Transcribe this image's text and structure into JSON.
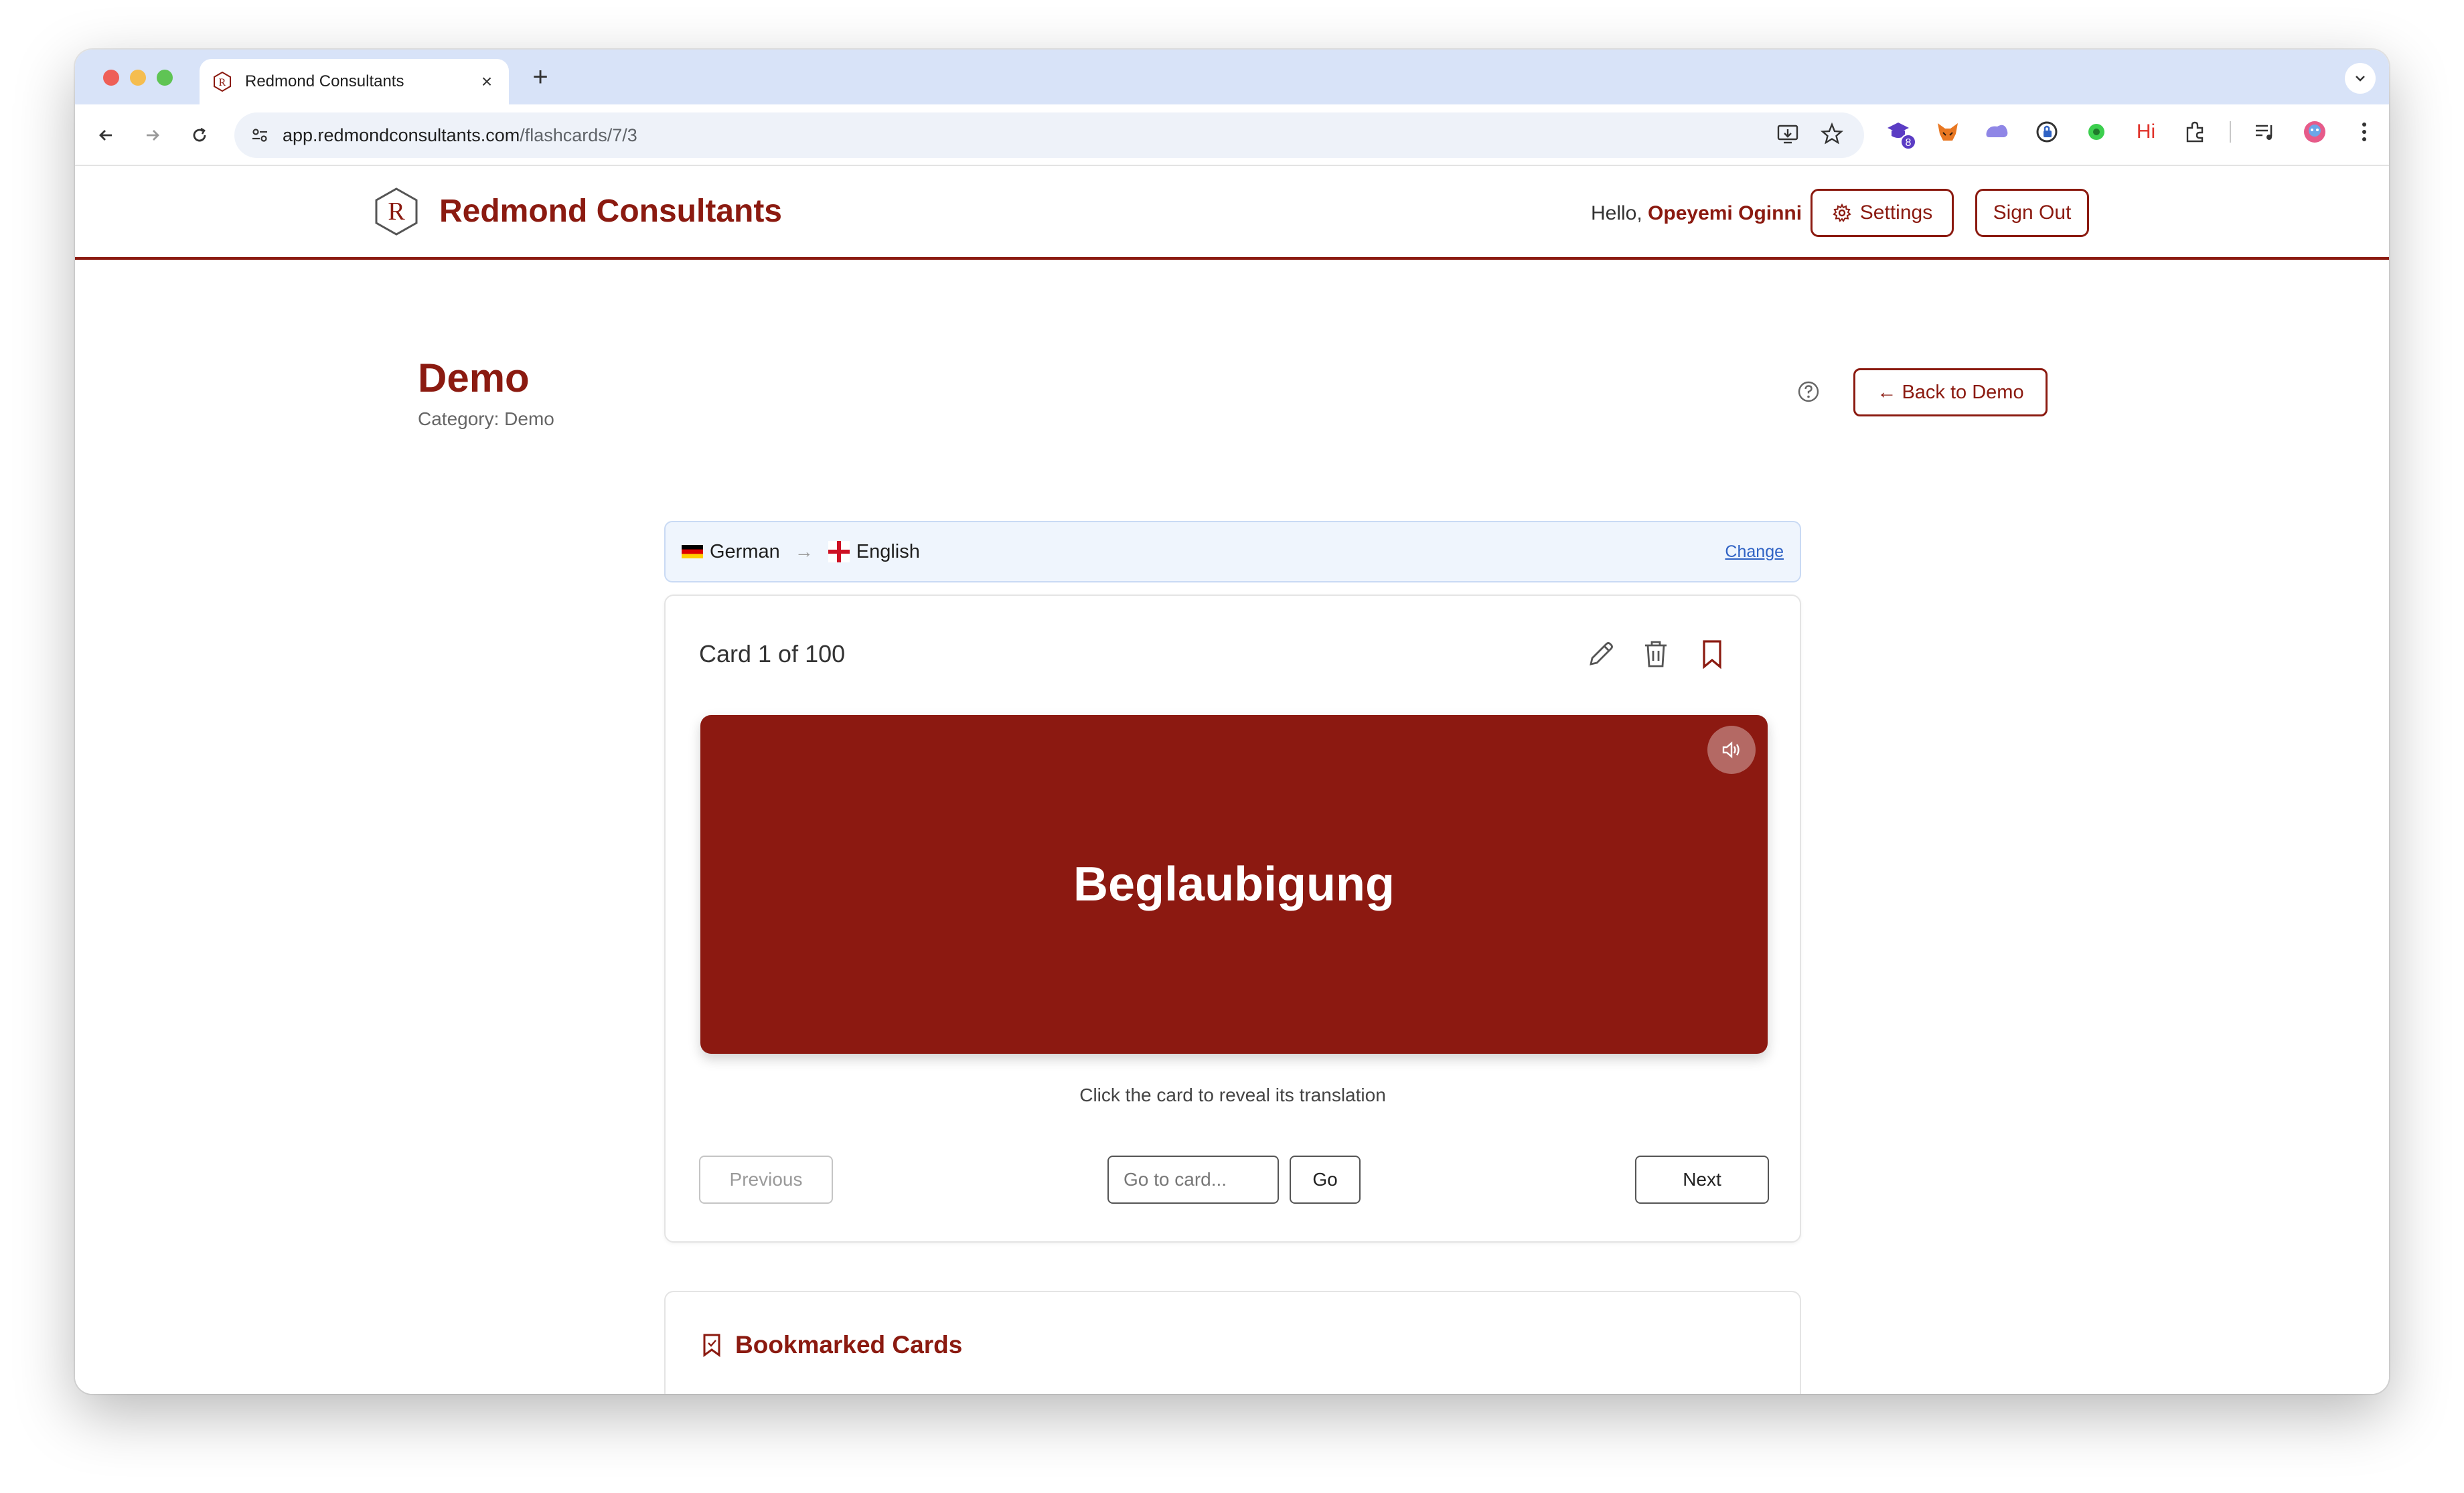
{
  "browser": {
    "tab_title": "Redmond Consultants",
    "tab_close": "×",
    "new_tab": "+",
    "url_domain": "app.redmondconsultants.com",
    "url_path": "/flashcards/7/3",
    "extension_badge": "8",
    "ext_hi": "Hi"
  },
  "header": {
    "brand": "Redmond Consultants",
    "greeting_prefix": "Hello, ",
    "user_name": "Opeyemi Oginni",
    "settings_label": "Settings",
    "signout_label": "Sign Out"
  },
  "deck": {
    "title": "Demo",
    "category": "Category: Demo",
    "back_label": "← Back to Demo"
  },
  "languages": {
    "source": "German",
    "arrow": "→",
    "target": "English",
    "change_label": "Change"
  },
  "card": {
    "counter": "Card 1 of 100",
    "word": "Beglaubigung",
    "hint": "Click the card to reveal its translation",
    "previous_label": "Previous",
    "goto_placeholder": "Go to card...",
    "go_label": "Go",
    "next_label": "Next"
  },
  "bookmarks": {
    "title": "Bookmarked Cards"
  },
  "colors": {
    "brand": "#8b1a10",
    "card_bg": "#8c1911",
    "link": "#2f62c4"
  }
}
